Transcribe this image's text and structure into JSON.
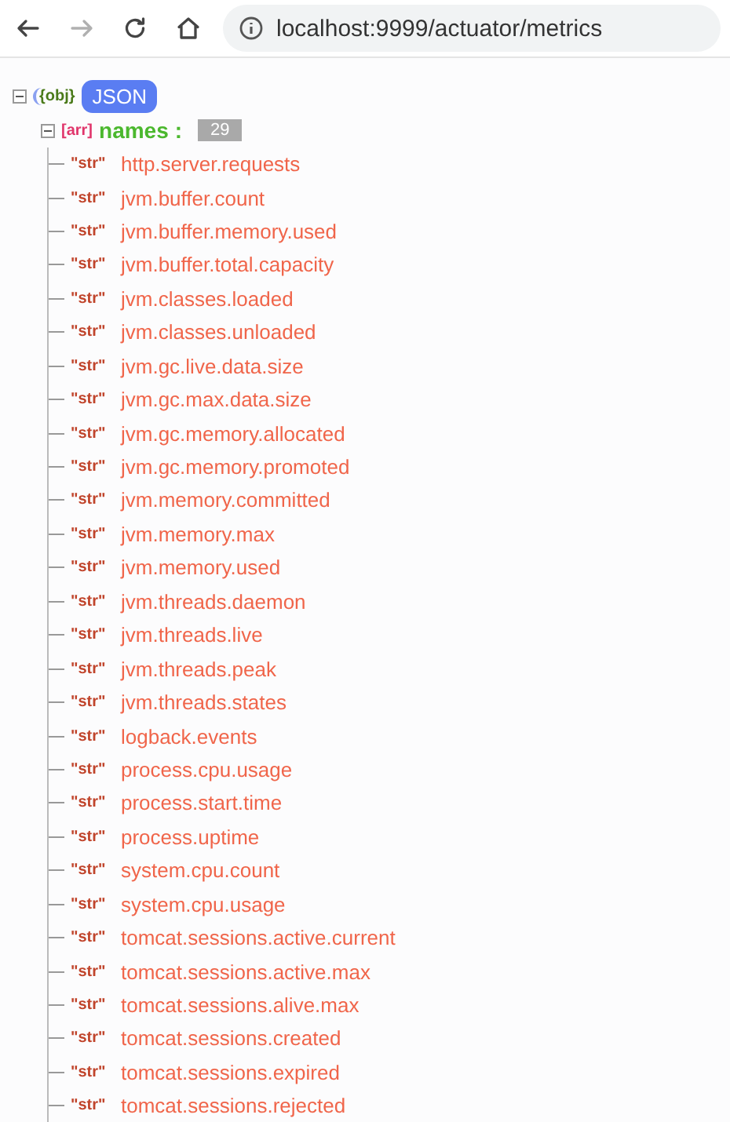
{
  "toolbar": {
    "back": {
      "disabled": false
    },
    "forward": {
      "disabled": true
    },
    "url": "localhost:9999/actuator/metrics"
  },
  "tree": {
    "type_tag": "{obj}",
    "label": "JSON",
    "expanded": true,
    "children": [
      {
        "type_tag": "[arr]",
        "key": "names",
        "separator": ":",
        "count": "29",
        "expanded": true,
        "items": [
          {
            "type_tag": "\"str\"",
            "value": "http.server.requests"
          },
          {
            "type_tag": "\"str\"",
            "value": "jvm.buffer.count"
          },
          {
            "type_tag": "\"str\"",
            "value": "jvm.buffer.memory.used"
          },
          {
            "type_tag": "\"str\"",
            "value": "jvm.buffer.total.capacity"
          },
          {
            "type_tag": "\"str\"",
            "value": "jvm.classes.loaded"
          },
          {
            "type_tag": "\"str\"",
            "value": "jvm.classes.unloaded"
          },
          {
            "type_tag": "\"str\"",
            "value": "jvm.gc.live.data.size"
          },
          {
            "type_tag": "\"str\"",
            "value": "jvm.gc.max.data.size"
          },
          {
            "type_tag": "\"str\"",
            "value": "jvm.gc.memory.allocated"
          },
          {
            "type_tag": "\"str\"",
            "value": "jvm.gc.memory.promoted"
          },
          {
            "type_tag": "\"str\"",
            "value": "jvm.memory.committed"
          },
          {
            "type_tag": "\"str\"",
            "value": "jvm.memory.max"
          },
          {
            "type_tag": "\"str\"",
            "value": "jvm.memory.used"
          },
          {
            "type_tag": "\"str\"",
            "value": "jvm.threads.daemon"
          },
          {
            "type_tag": "\"str\"",
            "value": "jvm.threads.live"
          },
          {
            "type_tag": "\"str\"",
            "value": "jvm.threads.peak"
          },
          {
            "type_tag": "\"str\"",
            "value": "jvm.threads.states"
          },
          {
            "type_tag": "\"str\"",
            "value": "logback.events"
          },
          {
            "type_tag": "\"str\"",
            "value": "process.cpu.usage"
          },
          {
            "type_tag": "\"str\"",
            "value": "process.start.time"
          },
          {
            "type_tag": "\"str\"",
            "value": "process.uptime"
          },
          {
            "type_tag": "\"str\"",
            "value": "system.cpu.count"
          },
          {
            "type_tag": "\"str\"",
            "value": "system.cpu.usage"
          },
          {
            "type_tag": "\"str\"",
            "value": "tomcat.sessions.active.current"
          },
          {
            "type_tag": "\"str\"",
            "value": "tomcat.sessions.active.max"
          },
          {
            "type_tag": "\"str\"",
            "value": "tomcat.sessions.alive.max"
          },
          {
            "type_tag": "\"str\"",
            "value": "tomcat.sessions.created"
          },
          {
            "type_tag": "\"str\"",
            "value": "tomcat.sessions.expired"
          },
          {
            "type_tag": "\"str\"",
            "value": "tomcat.sessions.rejected"
          }
        ]
      }
    ]
  }
}
